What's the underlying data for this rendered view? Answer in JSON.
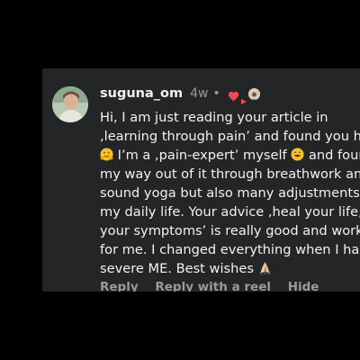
{
  "comment": {
    "username": "suguna_om",
    "time_ago": "4w",
    "separator": "•",
    "lines": [
      "Hi, I am just reading your article in",
      ",learning through pain’ and found you here",
      " I’m a ,pain-expert’ myself ",
      " and found",
      "my way out of it through breathwork and",
      "sound yoga but also many adjustments in",
      "my daily life. Your advice ,heal your life, not",
      "your symptoms’ is really good and worked",
      "for me. I changed everything when I had",
      "severe ME. Best wishes "
    ],
    "icons": {
      "liked_by_creator": "heart-icon",
      "creator_avatar": "creator-avatar",
      "emoji_1": "hugging-face-emoji",
      "emoji_2": "grinning-sweat-emoji",
      "emoji_3": "folded-hands-emoji"
    }
  },
  "actions": {
    "reply": "Reply",
    "reply_with_reel": "Reply with a reel",
    "hide": "Hide"
  },
  "colors": {
    "page_background": "#000000",
    "panel_background": "#242527",
    "primary_text": "#f2f2f2",
    "secondary_text": "#9a9a9a",
    "heart": "#ed4956"
  }
}
